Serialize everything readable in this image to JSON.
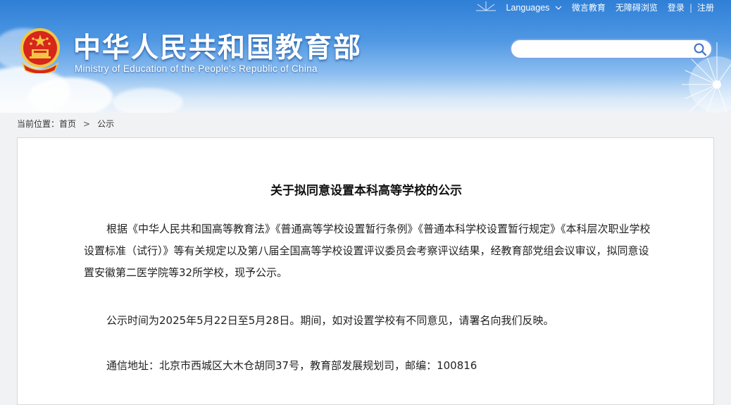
{
  "top_links": {
    "languages": "Languages",
    "weibo": "微言教育",
    "accessibility": "无障碍浏览",
    "login": "登录",
    "separator": "|",
    "register": "注册"
  },
  "site": {
    "title_cn": "中华人民共和国教育部",
    "title_en": "Ministry of Education of the People's Republic of China"
  },
  "search": {
    "placeholder": "",
    "value": ""
  },
  "breadcrumb": {
    "prefix": "当前位置：",
    "home": "首页",
    "current": "公示"
  },
  "article": {
    "title": "关于拟同意设置本科高等学校的公示",
    "paragraphs": [
      "根据《中华人民共和国高等教育法》《普通高等学校设置暂行条例》《普通本科学校设置暂行规定》《本科层次职业学校设置标准（试行）》等有关规定以及第八届全国高等学校设置评议委员会考察评议结果，经教育部党组会议审议，拟同意设置安徽第二医学院等32所学校，现予公示。",
      "公示时间为2025年5月22日至5月28日。期间，如对设置学校有不同意见，请署名向我们反映。",
      "通信地址：北京市西城区大木仓胡同37号，教育部发展规划司，邮编：100816"
    ]
  },
  "colors": {
    "header_blue": "#2f7fd6",
    "emblem_red": "#d7261b",
    "emblem_gold": "#f4c542",
    "search_border": "#7aa5e6"
  }
}
